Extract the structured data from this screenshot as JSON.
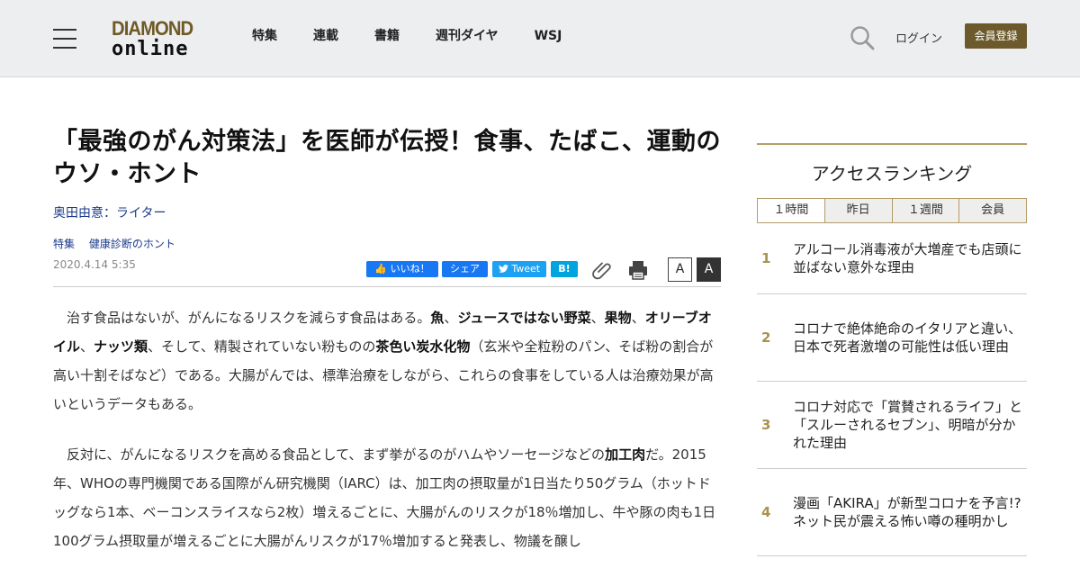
{
  "header": {
    "logo_top": "DIAMOND",
    "logo_bottom": "online",
    "nav": [
      "特集",
      "連載",
      "書籍",
      "週刊ダイヤ",
      "WSJ"
    ],
    "login_label": "ログイン",
    "register_label": "会員登録",
    "brand_color": "#6c5a2c"
  },
  "article": {
    "title": "「最強のがん対策法」を医師が伝授！食事、たばこ、運動のウソ・ホント",
    "author": "奥田由意：ライター",
    "tags": [
      "特集",
      "健康診断のホント"
    ],
    "date": "2020.4.14 5:35",
    "share": {
      "like": "いいね！",
      "share": "シェア",
      "tweet": "Tweet",
      "hatena": "B!"
    },
    "font_small_label": "A",
    "font_large_label": "A",
    "paragraph1": [
      {
        "t": "治す食品はないが、がんになるリスクを減らす食品はある。",
        "b": false
      },
      {
        "t": "魚",
        "b": true
      },
      {
        "t": "、",
        "b": false
      },
      {
        "t": "ジュースではない野菜",
        "b": true
      },
      {
        "t": "、",
        "b": false
      },
      {
        "t": "果物",
        "b": true
      },
      {
        "t": "、",
        "b": false
      },
      {
        "t": "オリーブオイル",
        "b": true
      },
      {
        "t": "、",
        "b": false
      },
      {
        "t": "ナッツ類",
        "b": true
      },
      {
        "t": "、そして、精製されていない粉ものの",
        "b": false
      },
      {
        "t": "茶色い炭水化物",
        "b": true
      },
      {
        "t": "（玄米や全粒粉のパン、そば粉の割合が高い十割そばなど）である。大腸がんでは、標準治療をしながら、これらの食事をしている人は治療効果が高いというデータもある。",
        "b": false
      }
    ],
    "paragraph2": [
      {
        "t": "反対に、がんになるリスクを高める食品として、まず挙がるのがハムやソーセージなどの",
        "b": false
      },
      {
        "t": "加工肉",
        "b": true
      },
      {
        "t": "だ。2015年、WHOの専門機関である国際がん研究機関（IARC）は、加工肉の摂取量が1日当たり50グラム（ホットドッグなら1本、ベーコンスライスなら2枚）増えるごとに、大腸がんのリスクが18％増加し、牛や豚の肉も1日100グラム摂取量が増えるごとに大腸がんリスクが17％増加すると発表し、物議を醸し",
        "b": false
      }
    ]
  },
  "sidebar": {
    "title": "アクセスランキング",
    "tabs": [
      "１時間",
      "昨日",
      "１週間",
      "会員"
    ],
    "active_tab": 0,
    "items": [
      {
        "rank": "1",
        "text": "アルコール消毒液が大増産でも店頭に並ばない意外な理由"
      },
      {
        "rank": "2",
        "text": "コロナで絶体絶命のイタリアと違い、日本で死者激増の可能性は低い理由"
      },
      {
        "rank": "3",
        "text": "コロナ対応で「賞賛されるライフ」と「スルーされるセブン」、明暗が分かれた理由"
      },
      {
        "rank": "4",
        "text": "漫画「AKIRA」が新型コロナを予言!?ネット民が震える怖い噂の種明かし"
      }
    ]
  }
}
